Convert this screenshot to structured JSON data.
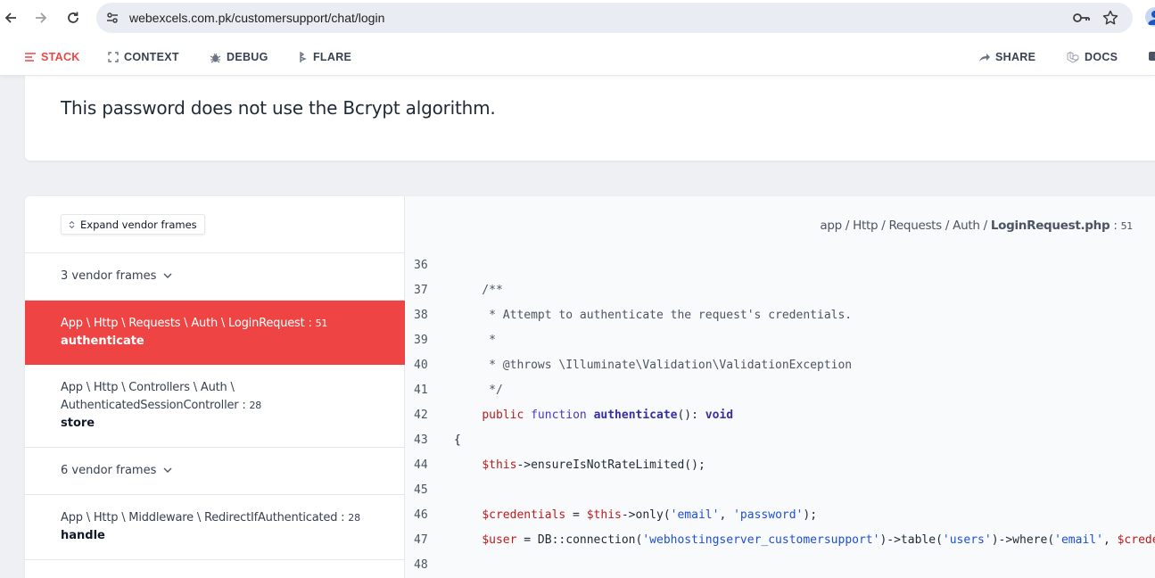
{
  "browser": {
    "url": "webexcels.com.pk/customersupport/chat/login",
    "back_icon": "arrow-left-icon",
    "forward_icon": "arrow-right-icon",
    "reload_icon": "reload-icon"
  },
  "toolbar": {
    "stack": "STACK",
    "context": "CONTEXT",
    "debug": "DEBUG",
    "flare": "FLARE",
    "share": "SHARE",
    "docs": "DOCS"
  },
  "error": {
    "message": "This password does not use the Bcrypt algorithm."
  },
  "frames_panel": {
    "expand_label": "Expand vendor frames",
    "rows": [
      {
        "kind": "vendor",
        "label": "3 vendor frames"
      },
      {
        "kind": "frame",
        "path": "App \\ Http \\ Requests \\ Auth \\ LoginRequest",
        "line": "51",
        "method": "authenticate",
        "selected": true
      },
      {
        "kind": "frame",
        "path_line1": "App \\ Http \\ Controllers \\ Auth \\",
        "path_line2": "AuthenticatedSessionController",
        "line": "28",
        "method": "store"
      },
      {
        "kind": "vendor",
        "label": "6 vendor frames"
      },
      {
        "kind": "frame",
        "path": "App \\ Http \\ Middleware \\ RedirectIfAuthenticated",
        "line": "28",
        "method": "handle"
      }
    ]
  },
  "code_panel": {
    "breadcrumb_prefix": "app / Http / Requests / Auth / ",
    "breadcrumb_file": "LoginRequest.php",
    "breadcrumb_line": "51",
    "lines": [
      {
        "n": "36",
        "text": ""
      },
      {
        "n": "37",
        "text": "    /**"
      },
      {
        "n": "38",
        "text": "     * Attempt to authenticate the request's credentials."
      },
      {
        "n": "39",
        "text": "     *"
      },
      {
        "n": "40",
        "text": "     * @throws \\Illuminate\\Validation\\ValidationException"
      },
      {
        "n": "41",
        "text": "     */"
      },
      {
        "n": "42",
        "text": "    public function authenticate(): void"
      },
      {
        "n": "43",
        "text": "{"
      },
      {
        "n": "44",
        "text": "    $this->ensureIsNotRateLimited();"
      },
      {
        "n": "45",
        "text": ""
      },
      {
        "n": "46",
        "text": "    $credentials = $this->only('email', 'password');"
      },
      {
        "n": "47",
        "text": "    $user = DB::connection('webhostingserver_customersupport')->table('users')->where('email', $credentials"
      },
      {
        "n": "48",
        "text": ""
      }
    ]
  },
  "colors": {
    "accent": "#ef4444",
    "keyword": "#b91c1c",
    "string": "#1d4ed8",
    "function": "#3730a3"
  }
}
